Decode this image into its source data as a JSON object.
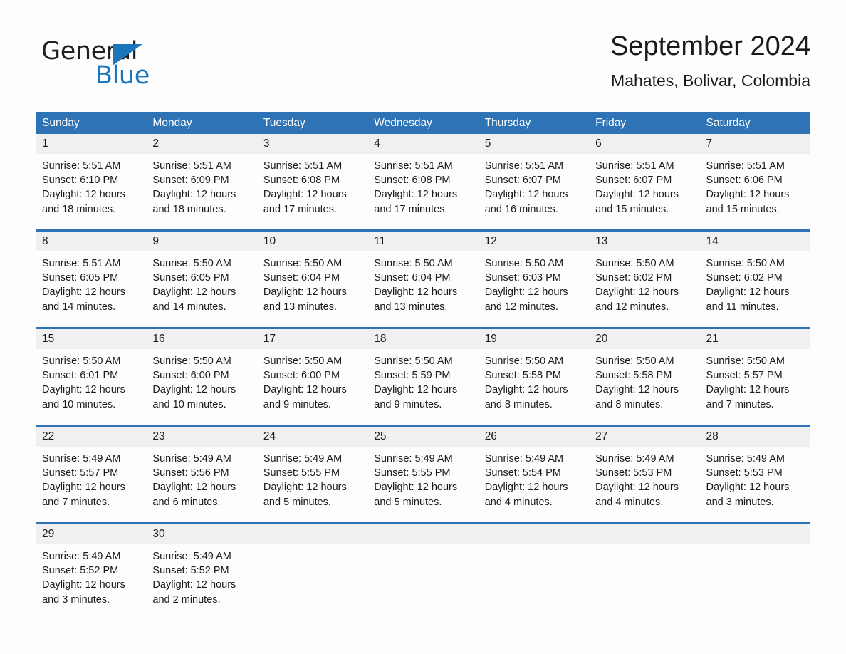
{
  "brand": {
    "name_part1": "General",
    "name_part2": "Blue",
    "triangle_color": "#1B75BB"
  },
  "header": {
    "title": "September 2024",
    "subtitle": "Mahates, Bolivar, Colombia"
  },
  "theme": {
    "header_blue": "#2E73B5",
    "day_band_gray": "#F0F0F0",
    "page_background": "#FDFDFD",
    "text_color": "#1A1A1A"
  },
  "weekday_headers": [
    "Sunday",
    "Monday",
    "Tuesday",
    "Wednesday",
    "Thursday",
    "Friday",
    "Saturday"
  ],
  "weeks": [
    {
      "numbers": [
        "1",
        "2",
        "3",
        "4",
        "5",
        "6",
        "7"
      ],
      "cells": [
        {
          "sunrise": "Sunrise: 5:51 AM",
          "sunset": "Sunset: 6:10 PM",
          "daylight1": "Daylight: 12 hours",
          "daylight2": "and 18 minutes."
        },
        {
          "sunrise": "Sunrise: 5:51 AM",
          "sunset": "Sunset: 6:09 PM",
          "daylight1": "Daylight: 12 hours",
          "daylight2": "and 18 minutes."
        },
        {
          "sunrise": "Sunrise: 5:51 AM",
          "sunset": "Sunset: 6:08 PM",
          "daylight1": "Daylight: 12 hours",
          "daylight2": "and 17 minutes."
        },
        {
          "sunrise": "Sunrise: 5:51 AM",
          "sunset": "Sunset: 6:08 PM",
          "daylight1": "Daylight: 12 hours",
          "daylight2": "and 17 minutes."
        },
        {
          "sunrise": "Sunrise: 5:51 AM",
          "sunset": "Sunset: 6:07 PM",
          "daylight1": "Daylight: 12 hours",
          "daylight2": "and 16 minutes."
        },
        {
          "sunrise": "Sunrise: 5:51 AM",
          "sunset": "Sunset: 6:07 PM",
          "daylight1": "Daylight: 12 hours",
          "daylight2": "and 15 minutes."
        },
        {
          "sunrise": "Sunrise: 5:51 AM",
          "sunset": "Sunset: 6:06 PM",
          "daylight1": "Daylight: 12 hours",
          "daylight2": "and 15 minutes."
        }
      ]
    },
    {
      "numbers": [
        "8",
        "9",
        "10",
        "11",
        "12",
        "13",
        "14"
      ],
      "cells": [
        {
          "sunrise": "Sunrise: 5:51 AM",
          "sunset": "Sunset: 6:05 PM",
          "daylight1": "Daylight: 12 hours",
          "daylight2": "and 14 minutes."
        },
        {
          "sunrise": "Sunrise: 5:50 AM",
          "sunset": "Sunset: 6:05 PM",
          "daylight1": "Daylight: 12 hours",
          "daylight2": "and 14 minutes."
        },
        {
          "sunrise": "Sunrise: 5:50 AM",
          "sunset": "Sunset: 6:04 PM",
          "daylight1": "Daylight: 12 hours",
          "daylight2": "and 13 minutes."
        },
        {
          "sunrise": "Sunrise: 5:50 AM",
          "sunset": "Sunset: 6:04 PM",
          "daylight1": "Daylight: 12 hours",
          "daylight2": "and 13 minutes."
        },
        {
          "sunrise": "Sunrise: 5:50 AM",
          "sunset": "Sunset: 6:03 PM",
          "daylight1": "Daylight: 12 hours",
          "daylight2": "and 12 minutes."
        },
        {
          "sunrise": "Sunrise: 5:50 AM",
          "sunset": "Sunset: 6:02 PM",
          "daylight1": "Daylight: 12 hours",
          "daylight2": "and 12 minutes."
        },
        {
          "sunrise": "Sunrise: 5:50 AM",
          "sunset": "Sunset: 6:02 PM",
          "daylight1": "Daylight: 12 hours",
          "daylight2": "and 11 minutes."
        }
      ]
    },
    {
      "numbers": [
        "15",
        "16",
        "17",
        "18",
        "19",
        "20",
        "21"
      ],
      "cells": [
        {
          "sunrise": "Sunrise: 5:50 AM",
          "sunset": "Sunset: 6:01 PM",
          "daylight1": "Daylight: 12 hours",
          "daylight2": "and 10 minutes."
        },
        {
          "sunrise": "Sunrise: 5:50 AM",
          "sunset": "Sunset: 6:00 PM",
          "daylight1": "Daylight: 12 hours",
          "daylight2": "and 10 minutes."
        },
        {
          "sunrise": "Sunrise: 5:50 AM",
          "sunset": "Sunset: 6:00 PM",
          "daylight1": "Daylight: 12 hours",
          "daylight2": "and 9 minutes."
        },
        {
          "sunrise": "Sunrise: 5:50 AM",
          "sunset": "Sunset: 5:59 PM",
          "daylight1": "Daylight: 12 hours",
          "daylight2": "and 9 minutes."
        },
        {
          "sunrise": "Sunrise: 5:50 AM",
          "sunset": "Sunset: 5:58 PM",
          "daylight1": "Daylight: 12 hours",
          "daylight2": "and 8 minutes."
        },
        {
          "sunrise": "Sunrise: 5:50 AM",
          "sunset": "Sunset: 5:58 PM",
          "daylight1": "Daylight: 12 hours",
          "daylight2": "and 8 minutes."
        },
        {
          "sunrise": "Sunrise: 5:50 AM",
          "sunset": "Sunset: 5:57 PM",
          "daylight1": "Daylight: 12 hours",
          "daylight2": "and 7 minutes."
        }
      ]
    },
    {
      "numbers": [
        "22",
        "23",
        "24",
        "25",
        "26",
        "27",
        "28"
      ],
      "cells": [
        {
          "sunrise": "Sunrise: 5:49 AM",
          "sunset": "Sunset: 5:57 PM",
          "daylight1": "Daylight: 12 hours",
          "daylight2": "and 7 minutes."
        },
        {
          "sunrise": "Sunrise: 5:49 AM",
          "sunset": "Sunset: 5:56 PM",
          "daylight1": "Daylight: 12 hours",
          "daylight2": "and 6 minutes."
        },
        {
          "sunrise": "Sunrise: 5:49 AM",
          "sunset": "Sunset: 5:55 PM",
          "daylight1": "Daylight: 12 hours",
          "daylight2": "and 5 minutes."
        },
        {
          "sunrise": "Sunrise: 5:49 AM",
          "sunset": "Sunset: 5:55 PM",
          "daylight1": "Daylight: 12 hours",
          "daylight2": "and 5 minutes."
        },
        {
          "sunrise": "Sunrise: 5:49 AM",
          "sunset": "Sunset: 5:54 PM",
          "daylight1": "Daylight: 12 hours",
          "daylight2": "and 4 minutes."
        },
        {
          "sunrise": "Sunrise: 5:49 AM",
          "sunset": "Sunset: 5:53 PM",
          "daylight1": "Daylight: 12 hours",
          "daylight2": "and 4 minutes."
        },
        {
          "sunrise": "Sunrise: 5:49 AM",
          "sunset": "Sunset: 5:53 PM",
          "daylight1": "Daylight: 12 hours",
          "daylight2": "and 3 minutes."
        }
      ]
    },
    {
      "numbers": [
        "29",
        "30",
        "",
        "",
        "",
        "",
        ""
      ],
      "cells": [
        {
          "sunrise": "Sunrise: 5:49 AM",
          "sunset": "Sunset: 5:52 PM",
          "daylight1": "Daylight: 12 hours",
          "daylight2": "and 3 minutes."
        },
        {
          "sunrise": "Sunrise: 5:49 AM",
          "sunset": "Sunset: 5:52 PM",
          "daylight1": "Daylight: 12 hours",
          "daylight2": "and 2 minutes."
        },
        {
          "sunrise": "",
          "sunset": "",
          "daylight1": "",
          "daylight2": ""
        },
        {
          "sunrise": "",
          "sunset": "",
          "daylight1": "",
          "daylight2": ""
        },
        {
          "sunrise": "",
          "sunset": "",
          "daylight1": "",
          "daylight2": ""
        },
        {
          "sunrise": "",
          "sunset": "",
          "daylight1": "",
          "daylight2": ""
        },
        {
          "sunrise": "",
          "sunset": "",
          "daylight1": "",
          "daylight2": ""
        }
      ]
    }
  ]
}
